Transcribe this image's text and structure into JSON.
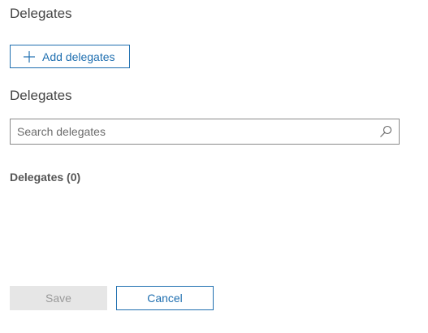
{
  "page": {
    "title": "Delegates"
  },
  "toolbar": {
    "add_label": "Add delegates",
    "add_icon": "plus-icon"
  },
  "delegates_section": {
    "title": "Delegates",
    "search": {
      "placeholder": "Search delegates",
      "value": "",
      "icon": "search-icon"
    },
    "list_header": "Delegates (0)",
    "items": []
  },
  "footer": {
    "save_label": "Save",
    "cancel_label": "Cancel"
  },
  "colors": {
    "accent": "#1f6fb0",
    "disabled_bg": "#e6e6e6",
    "disabled_text": "#9a9a9a",
    "border": "#8a8a8a"
  }
}
